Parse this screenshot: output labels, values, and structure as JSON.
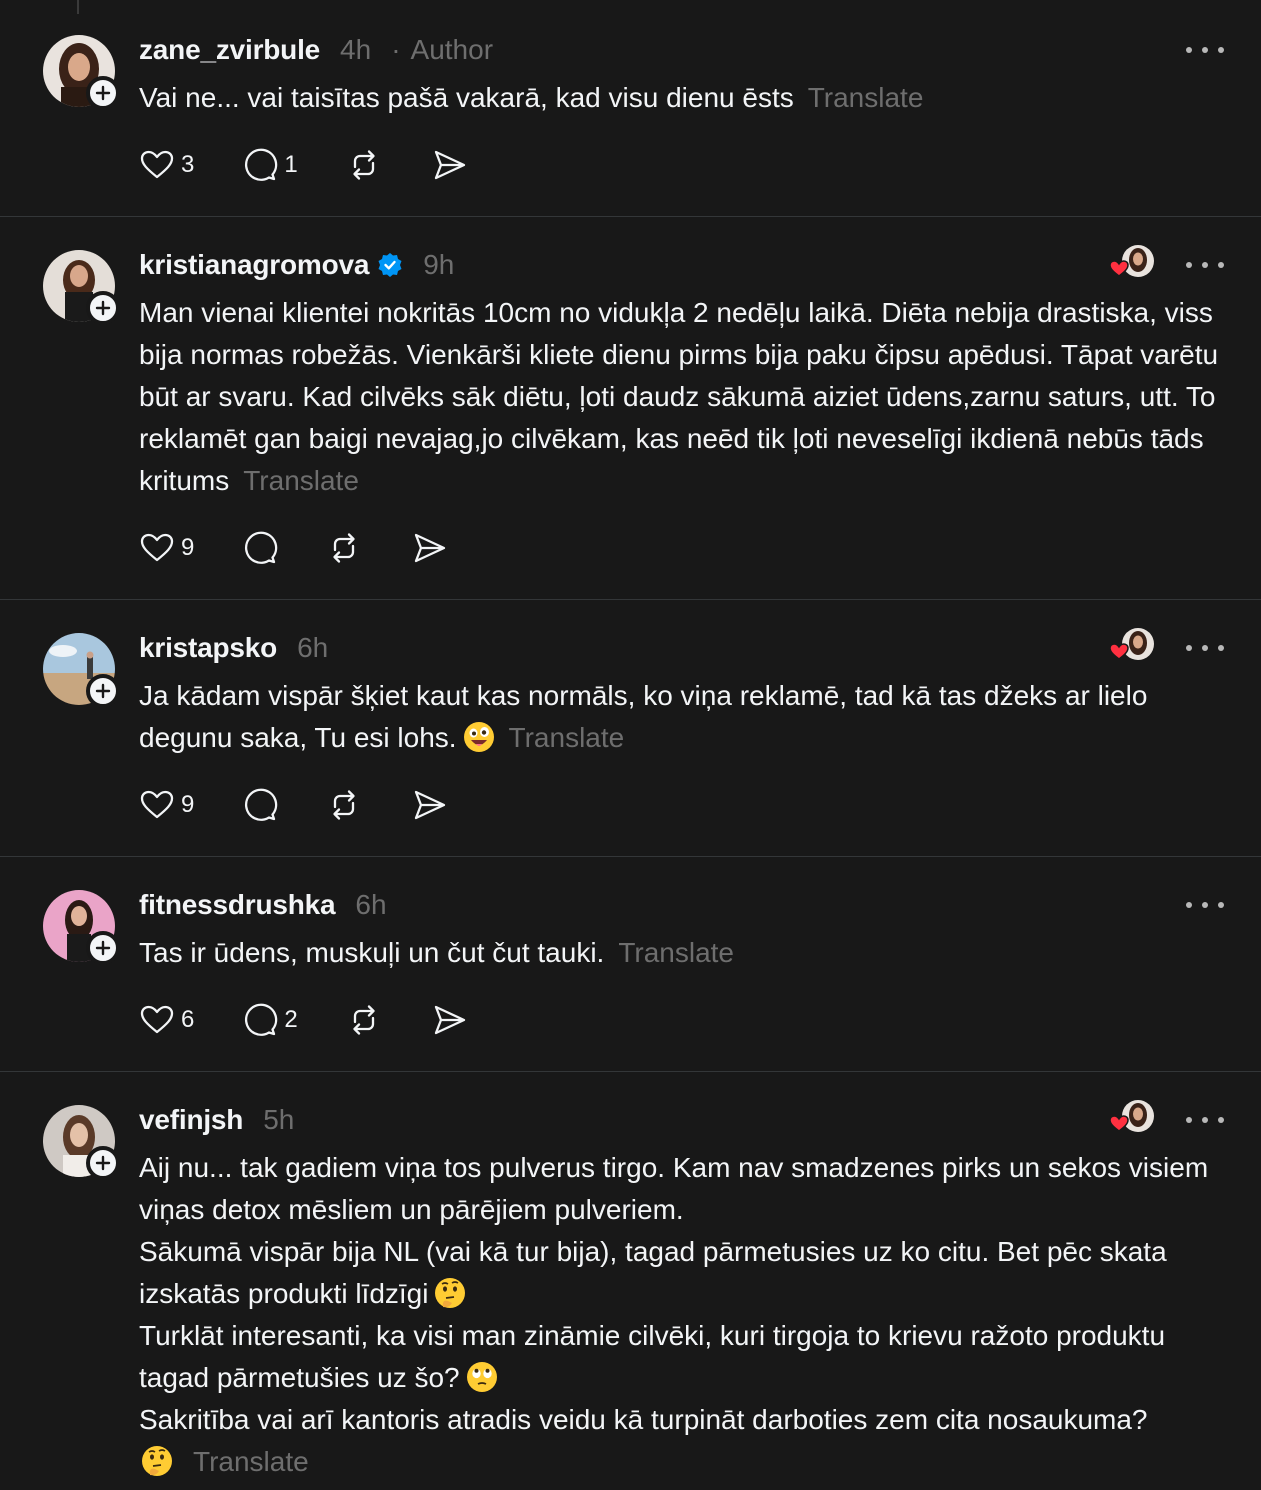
{
  "translate_label": "Translate",
  "posts": [
    {
      "username": "zane_zvirbule",
      "time": "4h",
      "author_sep": "·",
      "author_label": "Author",
      "verified": false,
      "liked_by_author": false,
      "paragraphs": [
        "Vai ne... vai taisītas pašā vakarā, kad visu dienu ēsts"
      ],
      "likes": "3",
      "replies": "1",
      "avatar_color": "#5a3a2a"
    },
    {
      "username": "kristianagromova",
      "time": "9h",
      "verified": true,
      "liked_by_author": true,
      "paragraphs": [
        "Man vienai klientei nokritās 10cm no vidukļa 2 nedēļu laikā. Diēta nebija drastiska, viss bija normas robežās. Vienkārši kliete dienu pirms bija paku čipsu apēdusi. Tāpat varētu būt ar svaru. Kad cilvēks sāk diētu, ļoti daudz sākumā aiziet ūdens,zarnu saturs, utt. To reklamēt gan baigi nevajag,jo cilvēkam, kas neēd tik ļoti neveselīgi ikdienā nebūs tāds kritums"
      ],
      "likes": "9",
      "replies": "",
      "avatar_color": "#6b4a3a"
    },
    {
      "username": "kristapsko",
      "time": "6h",
      "verified": false,
      "liked_by_author": true,
      "paragraphs": [
        "Ja kādam vispār šķiet kaut kas normāls, ko viņa reklamē, tad kā tas džeks ar lielo degunu saka, Tu esi lohs."
      ],
      "likes": "9",
      "replies": "",
      "avatar_color": "#8fb4d0"
    },
    {
      "username": "fitnessdrushka",
      "time": "6h",
      "verified": false,
      "liked_by_author": false,
      "paragraphs": [
        "Tas ir ūdens, muskuļi un čut čut tauki."
      ],
      "likes": "6",
      "replies": "2",
      "avatar_color": "#e6a7c6"
    },
    {
      "username": "vefinjsh",
      "time": "5h",
      "verified": false,
      "liked_by_author": true,
      "paragraphs": [
        "Aij nu... tak gadiem viņa tos pulverus tirgo. Kam nav smadzenes pirks un sekos visiem viņas detox mēsliem un pārējiem pulveriem.",
        "Sākumā vispār bija NL (vai kā tur bija), tagad pārmetusies uz ko citu. Bet pēc skata izskatās produkti līdzīgi",
        "Turklāt interesanti, ka visi man zināmie cilvēki, kuri tirgoja to krievu ražoto produktu tagad pārmetušies uz šo?",
        "Sakritība vai arī kantoris atradis veidu kā turpināt darboties zem cita nosaukuma?"
      ],
      "likes": "",
      "replies": "",
      "avatar_color": "#9a8a80"
    }
  ],
  "icons": {
    "like": "heart-icon",
    "reply": "comment-icon",
    "repost": "repost-icon",
    "share": "share-icon",
    "more": "more-icon",
    "follow": "plus-icon",
    "verified": "verified-badge-icon"
  },
  "colors": {
    "background": "#181818",
    "text": "#f3f5f7",
    "muted": "#6e6e6e",
    "divider": "#333638",
    "verified": "#0095f6",
    "heart": "#ff3040"
  }
}
